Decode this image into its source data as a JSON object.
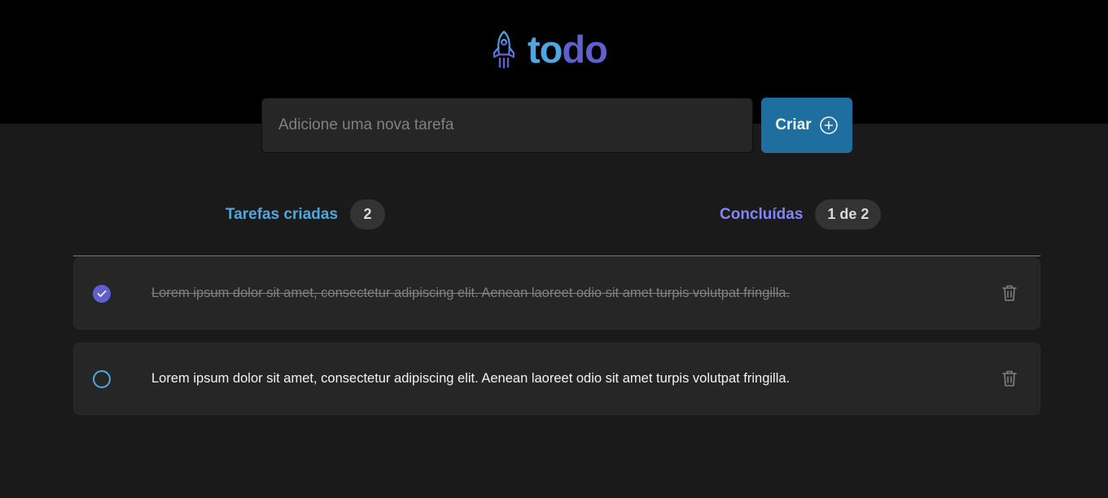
{
  "app": {
    "logo_text_1": "to",
    "logo_text_2": "do",
    "logo_icon": "rocket-icon"
  },
  "new_task": {
    "placeholder": "Adicione uma nova tarefa",
    "value": "",
    "button_label": "Criar",
    "button_icon": "plus-circle-icon"
  },
  "counters": {
    "created_label": "Tarefas criadas",
    "created_count": "2",
    "done_label": "Concluídas",
    "done_count": "1 de 2"
  },
  "tasks": [
    {
      "text": "Lorem ipsum dolor sit amet, consectetur adipiscing elit. Aenean laoreet odio sit amet turpis volutpat fringilla.",
      "completed": true
    },
    {
      "text": "Lorem ipsum dolor sit amet, consectetur adipiscing elit. Aenean laoreet odio sit amet turpis volutpat fringilla.",
      "completed": false
    }
  ],
  "colors": {
    "blue": "#4ea8de",
    "blue_dark": "#1e6f9f",
    "purple": "#5e60ce",
    "purple_light": "#8284fa",
    "background": "#1a1a1a",
    "header": "#000000"
  }
}
